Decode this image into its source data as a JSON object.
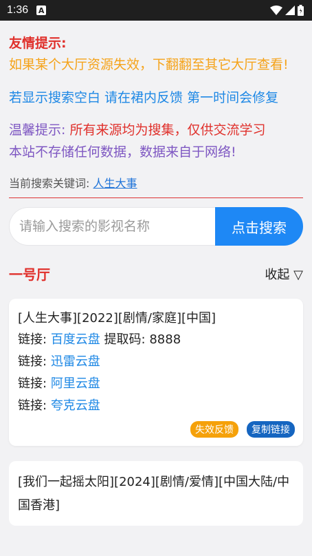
{
  "status_bar": {
    "time": "1:36",
    "a_glyph": "A"
  },
  "notice": {
    "title": "友情提示:",
    "orange_text": "如果某个大厅资源失效，下翻翻至其它大厅查看!",
    "blue_text": "若显示搜索空白 请在裙内反馈 第一时间会修复",
    "warm_label": "温馨提示:",
    "warm_red": "所有来源均为搜集，仅供交流学习",
    "warm_purple2": "本站不存储任何数据，数据来自于网络!"
  },
  "keyword": {
    "label": "当前搜索关键词:",
    "value": "人生大事"
  },
  "search": {
    "placeholder": "请输入搜索的影视名称",
    "button_label": "点击搜索"
  },
  "hall": {
    "title": "一号厅",
    "collapse_label": "收起 ▽"
  },
  "results": [
    {
      "title": "[人生大事][2022][剧情/家庭][中国]",
      "links": [
        {
          "prefix": "链接:",
          "name": "百度云盘",
          "extra": "提取码: 8888"
        },
        {
          "prefix": "链接:",
          "name": "迅雷云盘",
          "extra": ""
        },
        {
          "prefix": "链接:",
          "name": "阿里云盘",
          "extra": ""
        },
        {
          "prefix": "链接:",
          "name": "夸克云盘",
          "extra": ""
        }
      ],
      "feedback_label": "失效反馈",
      "copy_label": "复制链接"
    },
    {
      "title": "[我们一起摇太阳][2024][剧情/爱情][中国大陆/中国香港]"
    }
  ],
  "colors": {
    "accent": "#1e88f5",
    "red": "#e0302b",
    "orange": "#f5a31a",
    "purple": "#7e57c2"
  }
}
